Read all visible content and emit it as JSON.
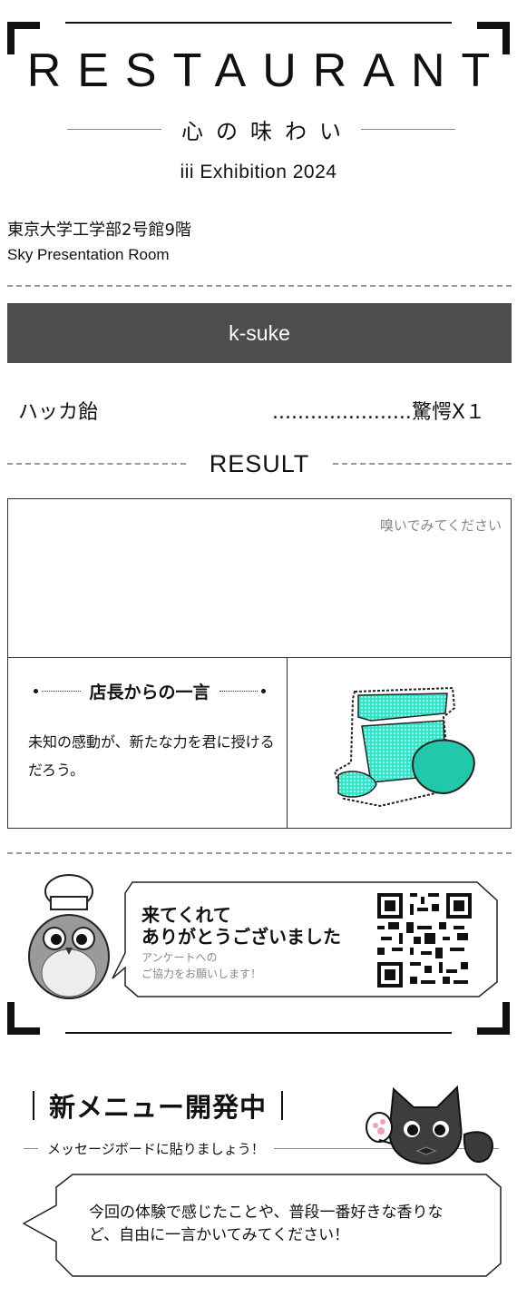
{
  "header": {
    "title": "RESTAURANT",
    "subtitle": "心の味わい",
    "exhibition": "iii Exhibition 2024"
  },
  "venue": {
    "location": "東京大学工学部2号館9階",
    "room": "Sky Presentation Room"
  },
  "guest": {
    "name": "k-suke"
  },
  "order": {
    "item": "ハッカ飴",
    "result": "......................驚愕X１"
  },
  "result": {
    "label": "RESULT",
    "smell_hint": "嗅いでみてください",
    "chief_title": "店長からの一言",
    "chief_message": "未知の感動が、新たな力を君に授けるだろう。",
    "image_icon": "mint-candy-icon"
  },
  "thanks": {
    "line1": "来てくれて",
    "line2": "ありがとうございました",
    "survey_line1": "アンケートへの",
    "survey_line2": "ご協力をお願いします！",
    "qr_icon": "qr-code-icon",
    "mascot_icon": "chef-owl-icon"
  },
  "new_menu": {
    "title": "新メニュー開発中",
    "message_board": "メッセージボードに貼りましょう！",
    "mascot_icon": "waving-cat-icon",
    "prompt": "今回の体験で感じたことや、普段一番好きな香りなど、自由に一言かいてみてください！"
  },
  "colors": {
    "name_bar": "#4d4d4d",
    "candy_accent": "#2fe6c8",
    "text": "#111111",
    "muted": "#888888"
  }
}
